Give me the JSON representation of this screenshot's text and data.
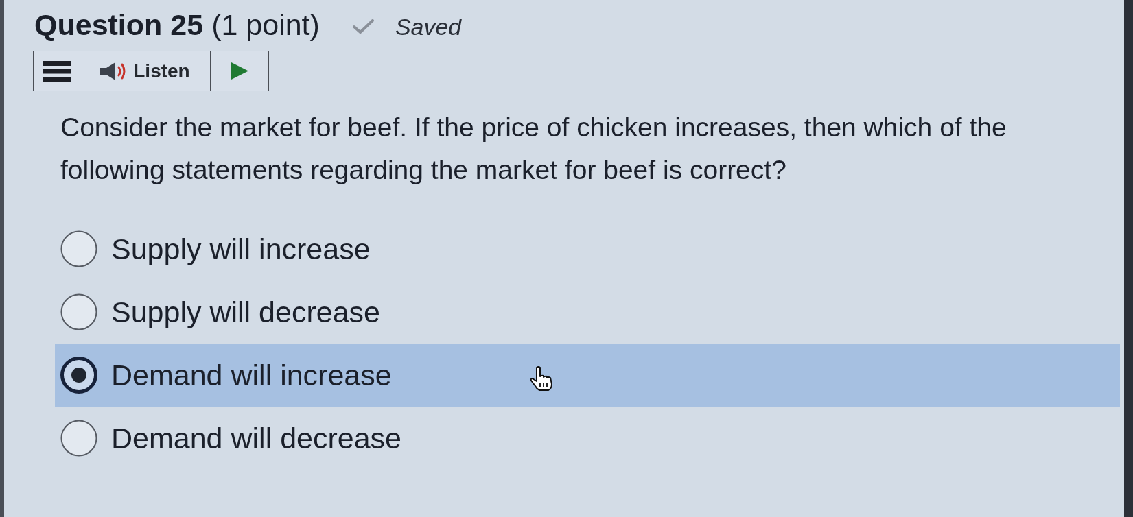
{
  "header": {
    "title": "Question 25",
    "points": "(1 point)",
    "status": "Saved"
  },
  "toolbar": {
    "listen_label": "Listen"
  },
  "prompt": "Consider the market for beef. If the price of chicken increases, then which of the following statements regarding the market for beef is correct?",
  "options": [
    {
      "label": "Supply will increase",
      "selected": false
    },
    {
      "label": "Supply will decrease",
      "selected": false
    },
    {
      "label": "Demand will increase",
      "selected": true
    },
    {
      "label": "Demand will decrease",
      "selected": false
    }
  ]
}
